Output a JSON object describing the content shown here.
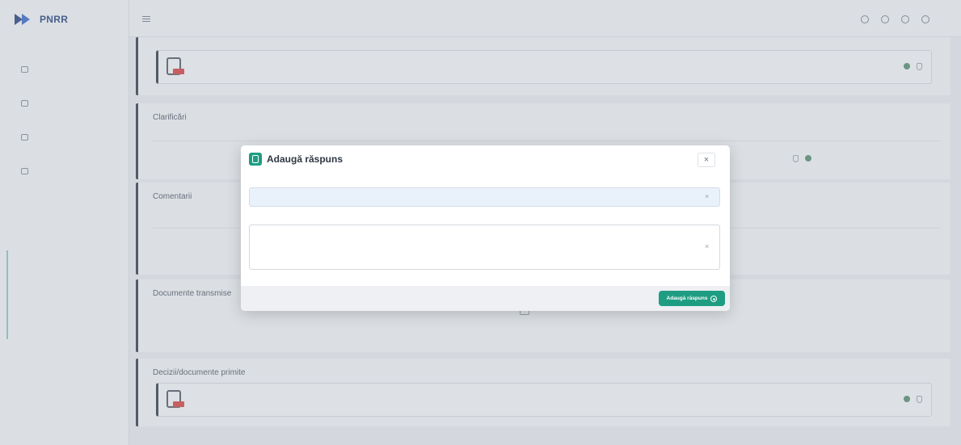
{
  "app": {
    "brand": "PNRR"
  },
  "sidebar": {
    "sections": [
      {
        "label": ""
      },
      {
        "label": ""
      },
      {
        "label": ""
      },
      {
        "label": ""
      },
      {
        "label": ""
      }
    ],
    "items": [
      {
        "label": "",
        "icon": "document-icon"
      },
      {
        "label": "",
        "icon": "grid-icon"
      },
      {
        "label": "",
        "icon": "chart-icon"
      },
      {
        "label": "",
        "icon": "user-icon"
      }
    ],
    "links": [
      {
        "label": ""
      },
      {
        "label": ""
      },
      {
        "label": ""
      },
      {
        "label": ""
      }
    ]
  },
  "topbar": {
    "user_name": "",
    "user_role": "",
    "icons": [
      "settings-icon",
      "bell-icon",
      "user-icon",
      "logout-icon"
    ]
  },
  "attachment": {
    "file_name": "",
    "file_size": "",
    "file_status": "",
    "badge": "PDF"
  },
  "clarifications": {
    "title": "Clarificări",
    "columns": [
      "",
      "",
      "",
      "",
      ""
    ],
    "rows": [
      {
        "cells": [
          "",
          "",
          "",
          "",
          ""
        ]
      }
    ]
  },
  "comments": {
    "title": "Comentarii",
    "columns": [
      "",
      "",
      ""
    ]
  },
  "documents_sent": {
    "title": "Documente transmise",
    "empty_text": ""
  },
  "decisions": {
    "title": "Decizii/documente primite",
    "file_name": "",
    "file_meta": "",
    "badge": "PDF"
  },
  "modal": {
    "title": "Adaugă răspuns",
    "close_label": "×",
    "subject_label": "",
    "subject_value": "",
    "content_label": "",
    "content_value": "",
    "char_count": "",
    "submit_label": "Adaugă răspuns"
  },
  "footer": {
    "line1": "",
    "line2": ""
  },
  "colors": {
    "accent": "#1e9d82",
    "brand": "#1d3a7a",
    "pdf_badge": "#d63a3a",
    "link": "#3c7bb5"
  }
}
